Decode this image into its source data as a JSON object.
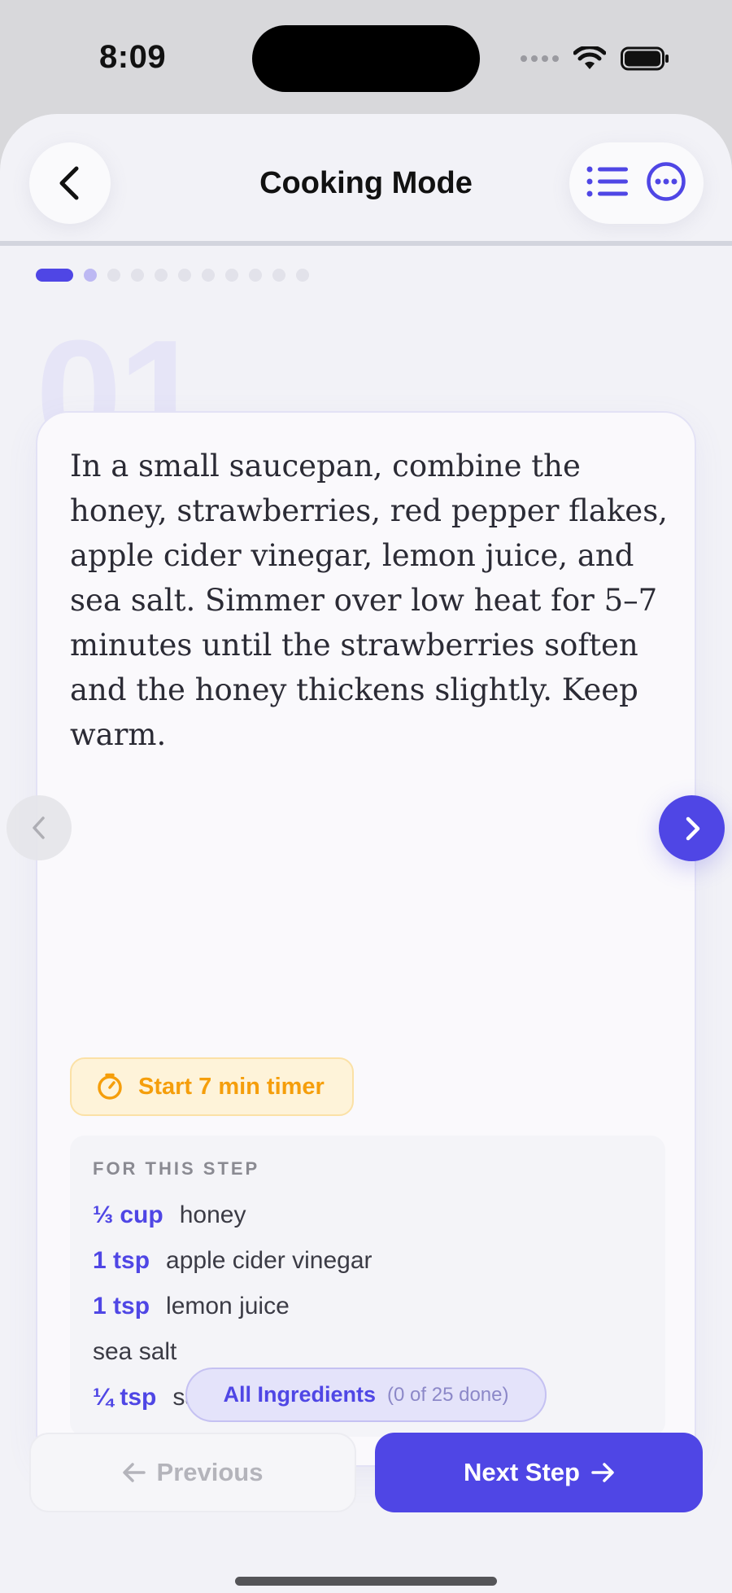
{
  "status_bar": {
    "time": "8:09"
  },
  "nav": {
    "title": "Cooking Mode",
    "back_icon": "chevron-left-icon",
    "list_icon": "list-icon",
    "more_icon": "more-circle-icon"
  },
  "progress": {
    "total_steps": 12,
    "current_step": 1
  },
  "step": {
    "number": "01",
    "text": "In a small saucepan, combine the honey, strawberries, red pepper flakes, apple cider vinegar, lemon juice, and sea salt. Simmer over low heat for 5–7 minutes until the strawberries soften and the honey thickens slightly. Keep warm.",
    "timer_label": "Start 7 min timer"
  },
  "step_ingredients": {
    "heading": "FOR THIS STEP",
    "items": [
      {
        "qty": "⅓ cup",
        "name": "honey"
      },
      {
        "qty": "1 tsp",
        "name": "apple cider vinegar"
      },
      {
        "qty": "1 tsp",
        "name": "lemon juice"
      },
      {
        "qty": "",
        "name": "sea salt"
      },
      {
        "qty": "¼ tsp",
        "name": "salt"
      }
    ]
  },
  "all_ingredients": {
    "label": "All Ingredients",
    "count": "(0 of 25 done)"
  },
  "footer": {
    "prev_label": "Previous",
    "next_label": "Next Step"
  },
  "colors": {
    "accent": "#4f46e5",
    "timer": "#f59e0b"
  }
}
